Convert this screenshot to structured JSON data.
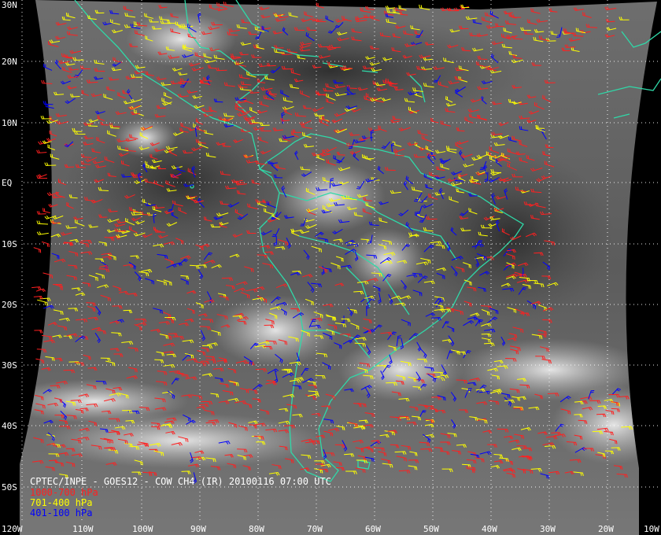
{
  "map": {
    "title": "CPTEC/INPE - GOES12 - COW CH4 (IR) 20100116 07:00 UTC",
    "projection": "geostationary satellite IR image with cloud-drift wind barbs",
    "background_color": "#000000",
    "coastline_color": "#2fd9a8",
    "grid_color": "#ffffff",
    "lat_labels": [
      "30N",
      "20N",
      "10N",
      "EQ",
      "10S",
      "20S",
      "30S",
      "40S",
      "50S"
    ],
    "lon_labels": [
      "120W",
      "110W",
      "100W",
      "90W",
      "80W",
      "70W",
      "60W",
      "50W",
      "40W",
      "30W",
      "20W",
      "10W"
    ],
    "legend": [
      {
        "label": "1000-700 hPa",
        "color": "#ff2020"
      },
      {
        "label": "701-400 hPa",
        "color": "#ffff00"
      },
      {
        "label": "401-100 hPa",
        "color": "#0000ff"
      }
    ]
  }
}
